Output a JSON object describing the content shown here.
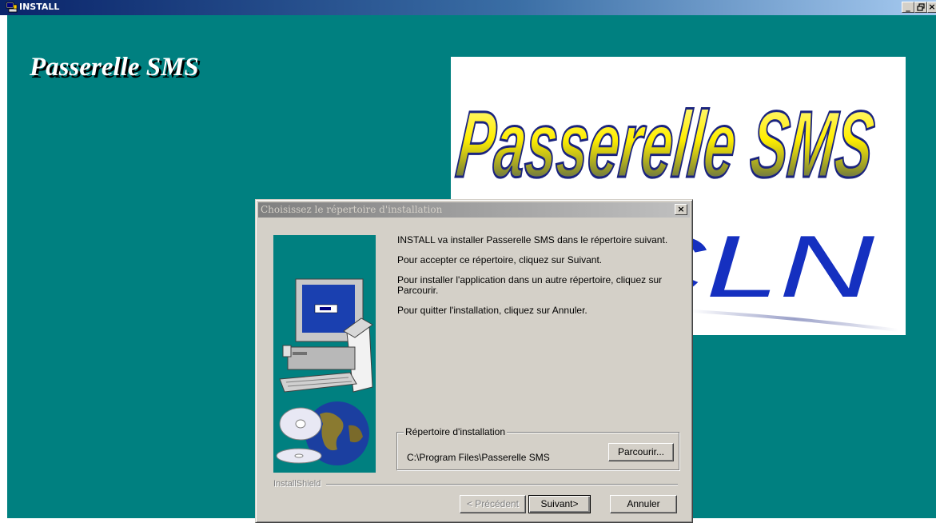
{
  "window": {
    "title": "INSTALL",
    "controls": [
      "_",
      "θ",
      "×"
    ]
  },
  "desktop": {
    "heading": "Passerelle SMS",
    "background": "#008080"
  },
  "logo": {
    "line1": "Passerelle SMS",
    "line2": "CLN"
  },
  "dialog": {
    "title": "Choisissez le répertoire d'installation",
    "close_label": "×",
    "paragraphs": [
      "INSTALL va installer Passerelle SMS dans le répertoire suivant.",
      "Pour accepter ce répertoire, cliquez sur Suivant.",
      "Pour installer l'application dans un autre répertoire, cliquez sur Parcourir.",
      "Pour quitter l'installation, cliquez sur Annuler."
    ],
    "group_label": "Répertoire d'installation",
    "install_path": "C:\\Program Files\\Passerelle SMS",
    "browse_label": "Parcourir...",
    "brand_label": "InstallShield",
    "back_label": "< Précédent",
    "next_label": "Suivant>",
    "cancel_label": "Annuler"
  }
}
